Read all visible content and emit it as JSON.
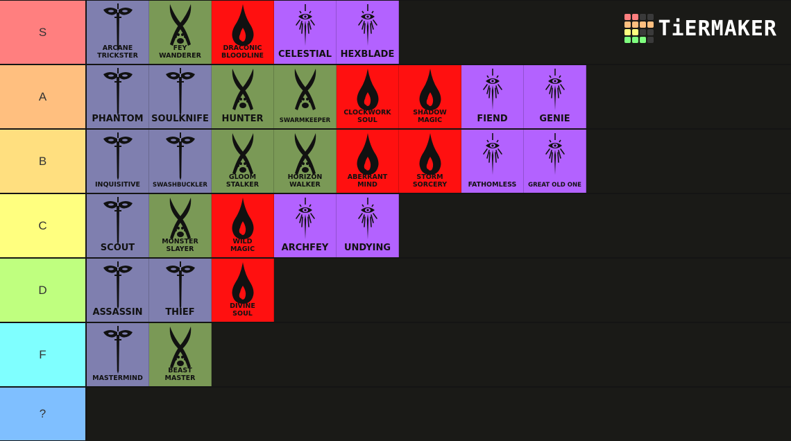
{
  "app": {
    "brand": "TiERMAKER"
  },
  "colors": {
    "rogue": "#7f7faf",
    "ranger": "#7a9956",
    "sorcerer": "#ff1010",
    "warlock": "#b362ff",
    "background": "#1a1a17"
  },
  "logo_grid_colors": [
    "#ff7f7f",
    "#ff7f7f",
    "#3a3a3a",
    "#3a3a3a",
    "#ffbf7f",
    "#ffbf7f",
    "#ffbf7f",
    "#ffbf7f",
    "#ffff7f",
    "#ffff7f",
    "#3a3a3a",
    "#3a3a3a",
    "#7fff7f",
    "#7fff7f",
    "#7fff7f",
    "#3a3a3a"
  ],
  "tiers": [
    {
      "label": "S",
      "color": "#ff7f7f",
      "items": [
        {
          "name": "ARCANE TRICKSTER",
          "class": "rogue",
          "icon": "mask-dagger-icon",
          "size": "small"
        },
        {
          "name": "FEY WANDERER",
          "class": "ranger",
          "icon": "crossed-swords-paw-icon",
          "size": "small"
        },
        {
          "name": "DRACONIC BLOODLINE",
          "class": "sorcerer",
          "icon": "flame-drop-icon",
          "size": "small"
        },
        {
          "name": "CELESTIAL",
          "class": "warlock",
          "icon": "eye-sigil-icon",
          "size": "big"
        },
        {
          "name": "HEXBLADE",
          "class": "warlock",
          "icon": "eye-sigil-icon",
          "size": "big"
        }
      ]
    },
    {
      "label": "A",
      "color": "#ffbf7f",
      "items": [
        {
          "name": "PHANTOM",
          "class": "rogue",
          "icon": "mask-dagger-icon",
          "size": "big"
        },
        {
          "name": "SOULKNIFE",
          "class": "rogue",
          "icon": "mask-dagger-icon",
          "size": "big"
        },
        {
          "name": "HUNTER",
          "class": "ranger",
          "icon": "crossed-swords-paw-icon",
          "size": "big"
        },
        {
          "name": "SWARMKEEPER",
          "class": "ranger",
          "icon": "crossed-swords-paw-icon",
          "size": "tiny"
        },
        {
          "name": "CLOCKWORK SOUL",
          "class": "sorcerer",
          "icon": "flame-drop-icon",
          "size": "small"
        },
        {
          "name": "SHADOW MAGIC",
          "class": "sorcerer",
          "icon": "flame-drop-icon",
          "size": "small"
        },
        {
          "name": "FIEND",
          "class": "warlock",
          "icon": "eye-sigil-icon",
          "size": "big"
        },
        {
          "name": "GENIE",
          "class": "warlock",
          "icon": "eye-sigil-icon",
          "size": "big"
        }
      ]
    },
    {
      "label": "B",
      "color": "#ffdf7f",
      "items": [
        {
          "name": "INQUISITIVE",
          "class": "rogue",
          "icon": "mask-dagger-icon",
          "size": "small"
        },
        {
          "name": "SWASHBUCKLER",
          "class": "rogue",
          "icon": "mask-dagger-icon",
          "size": "tiny"
        },
        {
          "name": "GLOOM STALKER",
          "class": "ranger",
          "icon": "crossed-swords-paw-icon",
          "size": "small"
        },
        {
          "name": "HORIZON WALKER",
          "class": "ranger",
          "icon": "crossed-swords-paw-icon",
          "size": "small"
        },
        {
          "name": "ABERRANT MIND",
          "class": "sorcerer",
          "icon": "flame-drop-icon",
          "size": "small"
        },
        {
          "name": "STORM SORCERY",
          "class": "sorcerer",
          "icon": "flame-drop-icon",
          "size": "small"
        },
        {
          "name": "FATHOMLESS",
          "class": "warlock",
          "icon": "eye-sigil-icon",
          "size": "small"
        },
        {
          "name": "GREAT OLD ONE",
          "class": "warlock",
          "icon": "eye-sigil-icon",
          "size": "tiny"
        }
      ]
    },
    {
      "label": "C",
      "color": "#ffff7f",
      "items": [
        {
          "name": "SCOUT",
          "class": "rogue",
          "icon": "mask-dagger-icon",
          "size": "big"
        },
        {
          "name": "MONSTER SLAYER",
          "class": "ranger",
          "icon": "crossed-swords-paw-icon",
          "size": "small"
        },
        {
          "name": "WILD MAGIC",
          "class": "sorcerer",
          "icon": "flame-drop-icon",
          "size": "small"
        },
        {
          "name": "ARCHFEY",
          "class": "warlock",
          "icon": "eye-sigil-icon",
          "size": "big"
        },
        {
          "name": "UNDYING",
          "class": "warlock",
          "icon": "eye-sigil-icon",
          "size": "big"
        }
      ]
    },
    {
      "label": "D",
      "color": "#bfff7f",
      "items": [
        {
          "name": "ASSASSIN",
          "class": "rogue",
          "icon": "mask-dagger-icon",
          "size": "big"
        },
        {
          "name": "THIEF",
          "class": "rogue",
          "icon": "mask-dagger-icon",
          "size": "big"
        },
        {
          "name": "DIVINE SOUL",
          "class": "sorcerer",
          "icon": "flame-drop-icon",
          "size": "small"
        }
      ]
    },
    {
      "label": "F",
      "color": "#7fffff",
      "items": [
        {
          "name": "MASTERMIND",
          "class": "rogue",
          "icon": "mask-dagger-icon",
          "size": "small"
        },
        {
          "name": "BEAST MASTER",
          "class": "ranger",
          "icon": "crossed-swords-paw-icon",
          "size": "small"
        }
      ]
    },
    {
      "label": "?",
      "color": "#7fbfff",
      "items": []
    }
  ]
}
